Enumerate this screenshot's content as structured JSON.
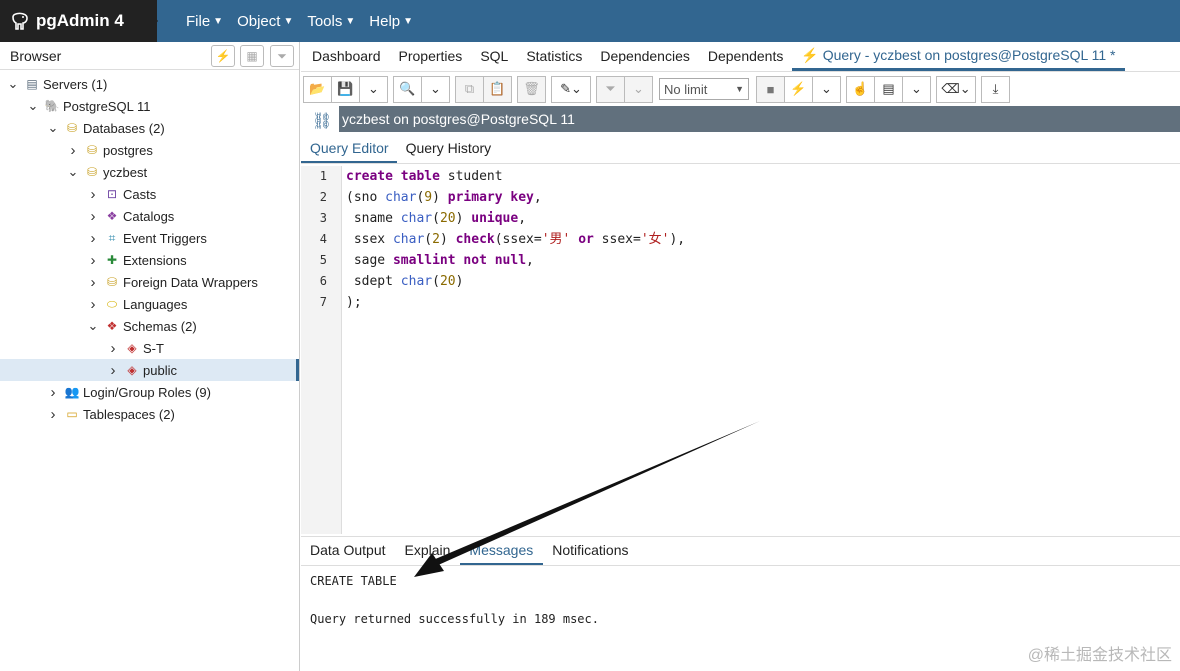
{
  "app": {
    "title": "pgAdmin 4",
    "menus": [
      {
        "label": "File"
      },
      {
        "label": "Object"
      },
      {
        "label": "Tools"
      },
      {
        "label": "Help"
      }
    ]
  },
  "browser": {
    "title": "Browser",
    "tree": [
      {
        "label": "Servers (1)",
        "level": 0,
        "expanded": true,
        "icon": "servers-icon"
      },
      {
        "label": "PostgreSQL 11",
        "level": 1,
        "expanded": true,
        "icon": "postgres-elephant-icon"
      },
      {
        "label": "Databases (2)",
        "level": 2,
        "expanded": true,
        "icon": "databases-icon"
      },
      {
        "label": "postgres",
        "level": 3,
        "expanded": false,
        "icon": "database-icon"
      },
      {
        "label": "yczbest",
        "level": 3,
        "expanded": true,
        "icon": "database-icon"
      },
      {
        "label": "Casts",
        "level": 4,
        "expanded": false,
        "icon": "casts-icon"
      },
      {
        "label": "Catalogs",
        "level": 4,
        "expanded": false,
        "icon": "catalogs-icon"
      },
      {
        "label": "Event Triggers",
        "level": 4,
        "expanded": false,
        "icon": "event-triggers-icon"
      },
      {
        "label": "Extensions",
        "level": 4,
        "expanded": false,
        "icon": "extensions-icon"
      },
      {
        "label": "Foreign Data Wrappers",
        "level": 4,
        "expanded": false,
        "icon": "foreign-data-wrappers-icon"
      },
      {
        "label": "Languages",
        "level": 4,
        "expanded": false,
        "icon": "languages-icon"
      },
      {
        "label": "Schemas (2)",
        "level": 4,
        "expanded": true,
        "icon": "schemas-icon"
      },
      {
        "label": "S-T",
        "level": 5,
        "expanded": false,
        "icon": "schema-icon"
      },
      {
        "label": "public",
        "level": 5,
        "expanded": false,
        "icon": "schema-icon",
        "selected": true
      },
      {
        "label": "Login/Group Roles (9)",
        "level": 2,
        "expanded": false,
        "icon": "roles-icon"
      },
      {
        "label": "Tablespaces (2)",
        "level": 2,
        "expanded": false,
        "icon": "tablespaces-icon"
      }
    ]
  },
  "tabs": [
    {
      "label": "Dashboard"
    },
    {
      "label": "Properties"
    },
    {
      "label": "SQL"
    },
    {
      "label": "Statistics"
    },
    {
      "label": "Dependencies"
    },
    {
      "label": "Dependents"
    },
    {
      "label": "Query - yczbest on postgres@PostgreSQL 11 *",
      "active": true
    }
  ],
  "toolbar": {
    "limit_label": "No limit"
  },
  "connection": {
    "label": "yczbest on postgres@PostgreSQL 11"
  },
  "query_tabs": [
    {
      "label": "Query Editor",
      "active": true
    },
    {
      "label": "Query History"
    }
  ],
  "editor": {
    "lines": [
      {
        "n": "1",
        "text": "create table student"
      },
      {
        "n": "2",
        "text": "(sno char(9) primary key,"
      },
      {
        "n": "3",
        "text": " sname char(20) unique,"
      },
      {
        "n": "4",
        "text": " ssex char(2) check(ssex='男' or ssex='女'),"
      },
      {
        "n": "5",
        "text": " sage smallint not null,"
      },
      {
        "n": "6",
        "text": " sdept char(20)"
      },
      {
        "n": "7",
        "text": ");"
      }
    ]
  },
  "result_tabs": [
    {
      "label": "Data Output"
    },
    {
      "label": "Explain"
    },
    {
      "label": "Messages",
      "active": true
    },
    {
      "label": "Notifications"
    }
  ],
  "messages": {
    "line1": "CREATE TABLE",
    "line2": "Query returned successfully in 189 msec."
  },
  "watermark": "@稀土掘金技术社区",
  "colors": {
    "navbar": "#326690",
    "brand": "#222222",
    "accent": "#326690",
    "connection_bar": "#61707d"
  }
}
